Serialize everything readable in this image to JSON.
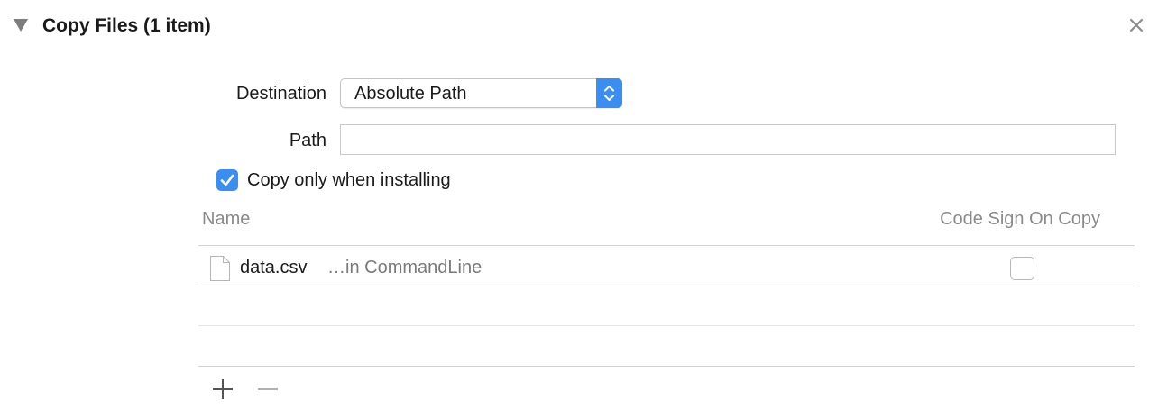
{
  "phase": {
    "title": "Copy Files (1 item)",
    "disclosure_icon": "triangle-down-icon",
    "close_icon": "close-icon"
  },
  "destination": {
    "label": "Destination",
    "selected": "Absolute Path"
  },
  "path": {
    "label": "Path",
    "value": "",
    "placeholder": ""
  },
  "copy_only_installing": {
    "label": "Copy only when installing",
    "checked": true
  },
  "table": {
    "columns": [
      "Name",
      "Code Sign On Copy"
    ],
    "rows": [
      {
        "name": "data.csv",
        "location": "…in CommandLine",
        "icon": "document-icon",
        "code_sign_on_copy": false
      }
    ]
  },
  "footer": {
    "add_icon": "plus-icon",
    "remove_icon": "minus-icon"
  },
  "colors": {
    "accent": "#3b8ef1",
    "secondary_text": "#8a8a8a",
    "separator": "#e4e4e4"
  }
}
